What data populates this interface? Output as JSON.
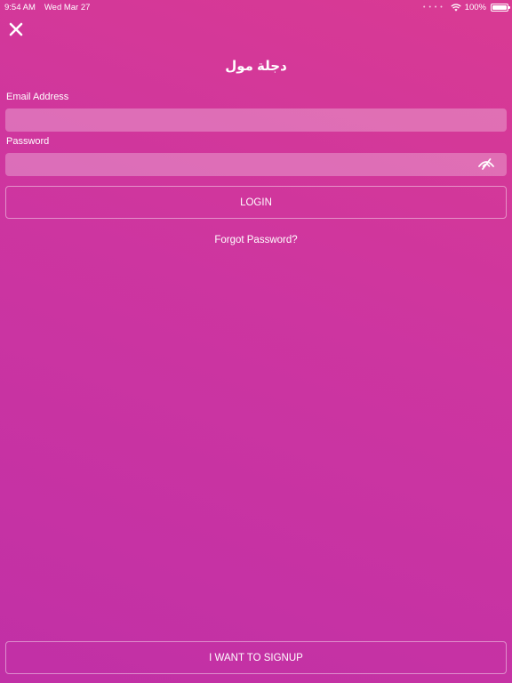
{
  "status_bar": {
    "time": "9:54 AM",
    "date": "Wed Mar 27",
    "battery": "100%",
    "icons": [
      "signal-dots-icon",
      "wifi-icon",
      "battery-icon"
    ]
  },
  "header": {
    "close_icon": "close-icon",
    "title": "دجلة مول"
  },
  "form": {
    "email_label": "Email Address",
    "email_value": "",
    "password_label": "Password",
    "password_value": "",
    "password_toggle_icon": "eye-slash-icon",
    "login_label": "LOGIN",
    "forgot_label": "Forgot Password?"
  },
  "footer": {
    "signup_label": "I WANT TO SIGNUP"
  },
  "colors": {
    "gradient_top": "#d93a93",
    "gradient_bottom": "#c130a6",
    "text": "#ffffff"
  }
}
